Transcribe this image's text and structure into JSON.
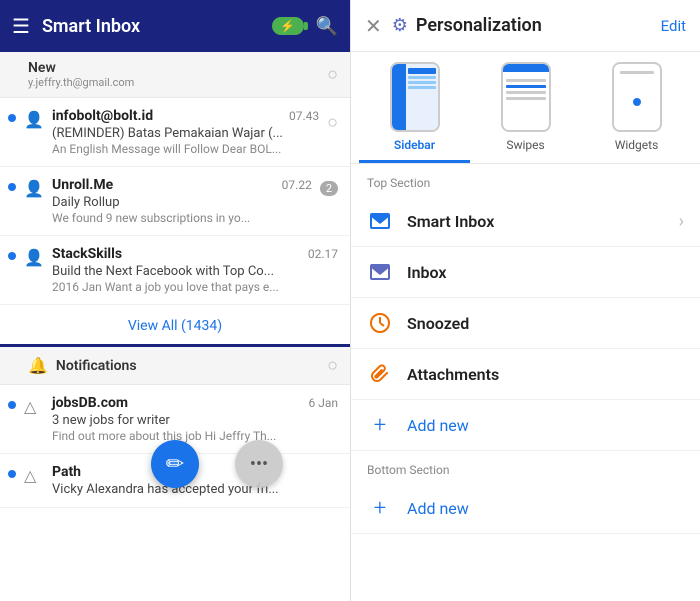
{
  "left": {
    "header": {
      "title": "Smart Inbox",
      "hamburger": "☰",
      "battery_bolt": "⚡",
      "search": "🔍"
    },
    "new_section": {
      "label": "New",
      "subtitle": "y.jeffry.th@gmail.com"
    },
    "emails": [
      {
        "sender": "infobolt@bolt.id",
        "time": "07.43",
        "subject": "(REMINDER) Batas Pemakaian Wajar (...",
        "preview": "An English Message will Follow Dear BOL...",
        "unread": true,
        "has_check": true
      },
      {
        "sender": "Unroll.Me",
        "time": "07.22",
        "subject": "Daily Rollup",
        "preview": "We found 9 new subscriptions in yo...",
        "unread": true,
        "badge": "2",
        "has_check": false
      },
      {
        "sender": "StackSkills",
        "time": "02.17",
        "subject": "Build the Next Facebook with Top Co...",
        "preview": "2016 Jan Want a job you love that pays e...",
        "unread": true,
        "has_check": false
      }
    ],
    "view_all": "View All (1434)",
    "notifications": {
      "label": "Notifications",
      "items": [
        {
          "sender": "jobsDB.com",
          "time": "6 Jan",
          "subject": "3 new jobs for writer",
          "preview": "Find out more about this job Hi Jeffry Th...",
          "unread": true
        },
        {
          "sender": "Path",
          "time": "",
          "subject": "Vicky Alexandra has accepted your fri...",
          "preview": "",
          "unread": true
        }
      ]
    },
    "fab": {
      "icon": "✏",
      "more": "•••"
    }
  },
  "right": {
    "header": {
      "title": "Personalization",
      "edit": "Edit",
      "close": "✕"
    },
    "tabs": [
      {
        "label": "Sidebar",
        "active": true
      },
      {
        "label": "Swipes",
        "active": false
      },
      {
        "label": "Widgets",
        "active": false
      }
    ],
    "top_section_label": "Top Section",
    "menu_items": [
      {
        "id": "smart-inbox",
        "icon": "✉",
        "icon_type": "smart",
        "label": "Smart Inbox",
        "has_chevron": true
      },
      {
        "id": "inbox",
        "icon": "✉",
        "icon_type": "inbox",
        "label": "Inbox",
        "has_chevron": false
      },
      {
        "id": "snoozed",
        "icon": "🕐",
        "icon_type": "snoozed",
        "label": "Snoozed",
        "has_chevron": false
      },
      {
        "id": "attachments",
        "icon": "📎",
        "icon_type": "attachments",
        "label": "Attachments",
        "has_chevron": false
      },
      {
        "id": "add-new-top",
        "icon": "+",
        "icon_type": "add",
        "label": "Add new",
        "has_chevron": false
      }
    ],
    "bottom_section_label": "Bottom Section",
    "bottom_items": [
      {
        "id": "add-new-bottom",
        "icon": "+",
        "icon_type": "add",
        "label": "Add new",
        "has_chevron": false
      }
    ]
  }
}
